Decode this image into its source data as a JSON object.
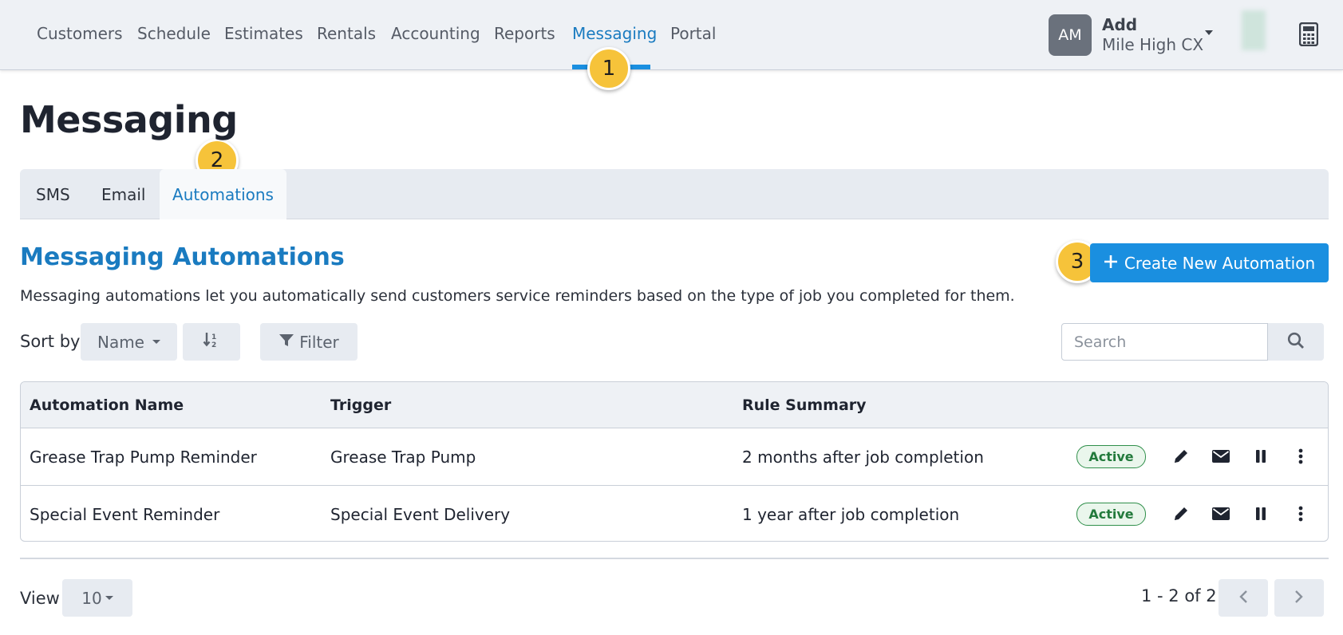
{
  "nav": {
    "items": [
      {
        "label": "Customers"
      },
      {
        "label": "Schedule"
      },
      {
        "label": "Estimates"
      },
      {
        "label": "Rentals"
      },
      {
        "label": "Accounting"
      },
      {
        "label": "Reports"
      },
      {
        "label": "Messaging",
        "active": true
      },
      {
        "label": "Portal"
      }
    ],
    "account": {
      "initials": "AM",
      "name": "Add",
      "org": "Mile High CX"
    },
    "active_color": "#1a7bc0"
  },
  "steps": [
    "1",
    "2",
    "3"
  ],
  "page": {
    "title": "Messaging"
  },
  "tabs": [
    {
      "label": "SMS"
    },
    {
      "label": "Email"
    },
    {
      "label": "Automations",
      "active": true
    }
  ],
  "section": {
    "title": "Messaging Automations",
    "description": "Messaging automations let you automatically send customers service reminders based on the type of job you completed for them.",
    "create_button": "Create New Automation"
  },
  "toolbar": {
    "sort_label": "Sort by",
    "sort_value": "Name",
    "filter_label": "Filter",
    "search_placeholder": "Search"
  },
  "table": {
    "columns": [
      "Automation Name",
      "Trigger",
      "Rule Summary"
    ],
    "rows": [
      {
        "name": "Grease Trap Pump Reminder",
        "trigger": "Grease Trap Pump",
        "rule": "2 months after job completion",
        "status": "Active"
      },
      {
        "name": "Special Event Reminder",
        "trigger": "Special Event Delivery",
        "rule": "1 year after job completion",
        "status": "Active"
      }
    ]
  },
  "footer": {
    "view_label": "View",
    "page_size": "10",
    "range": "1 - 2 of 2"
  },
  "colors": {
    "primary": "#1a8fe0",
    "step_badge": "#f6c33a",
    "active_badge": "#237a3c"
  }
}
